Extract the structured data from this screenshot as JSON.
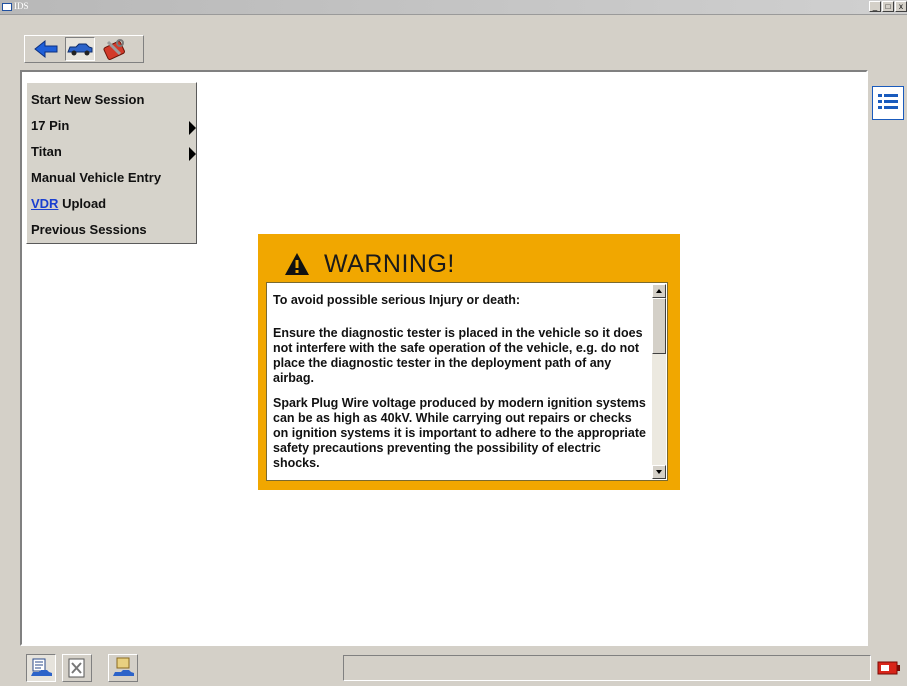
{
  "window": {
    "title": "IDS",
    "controls": [
      "_",
      "□",
      "x"
    ]
  },
  "toolbar": {
    "buttons": [
      {
        "icon": "back-arrow-icon"
      },
      {
        "icon": "vehicle-icon"
      },
      {
        "icon": "toolbox-icon"
      }
    ]
  },
  "menu": {
    "items": [
      {
        "label": "Start New Session",
        "submenu": false
      },
      {
        "label": "17 Pin",
        "submenu": true
      },
      {
        "label": "Titan",
        "submenu": true
      },
      {
        "label": "Manual Vehicle Entry",
        "submenu": false
      },
      {
        "link": "VDR",
        "label": " Upload",
        "submenu": false
      },
      {
        "label": "Previous Sessions",
        "submenu": false
      }
    ]
  },
  "warning": {
    "title": "WARNING!",
    "paragraphs": [
      "To avoid possible serious Injury or death:",
      "Ensure the diagnostic tester is placed in the vehicle so it does not interfere with the safe operation of the vehicle, e.g. do not place the diagnostic tester in the deployment path of any airbag.",
      "Spark Plug Wire voltage produced by modern ignition systems can be as high as 40kV. While carrying out repairs or checks on ignition systems it is important to adhere to the appropriate safety precautions preventing the possibility of electric shocks."
    ]
  },
  "bottombar": {
    "buttons": [
      {
        "icon": "session-vehicle-icon"
      },
      {
        "icon": "toolbox-document-icon"
      },
      {
        "icon": "vehicle-upload-icon"
      }
    ],
    "status_text": ""
  },
  "colors": {
    "warning_bg": "#f1a700",
    "link": "#1a3fd0",
    "accent": "#1a5bbd"
  }
}
